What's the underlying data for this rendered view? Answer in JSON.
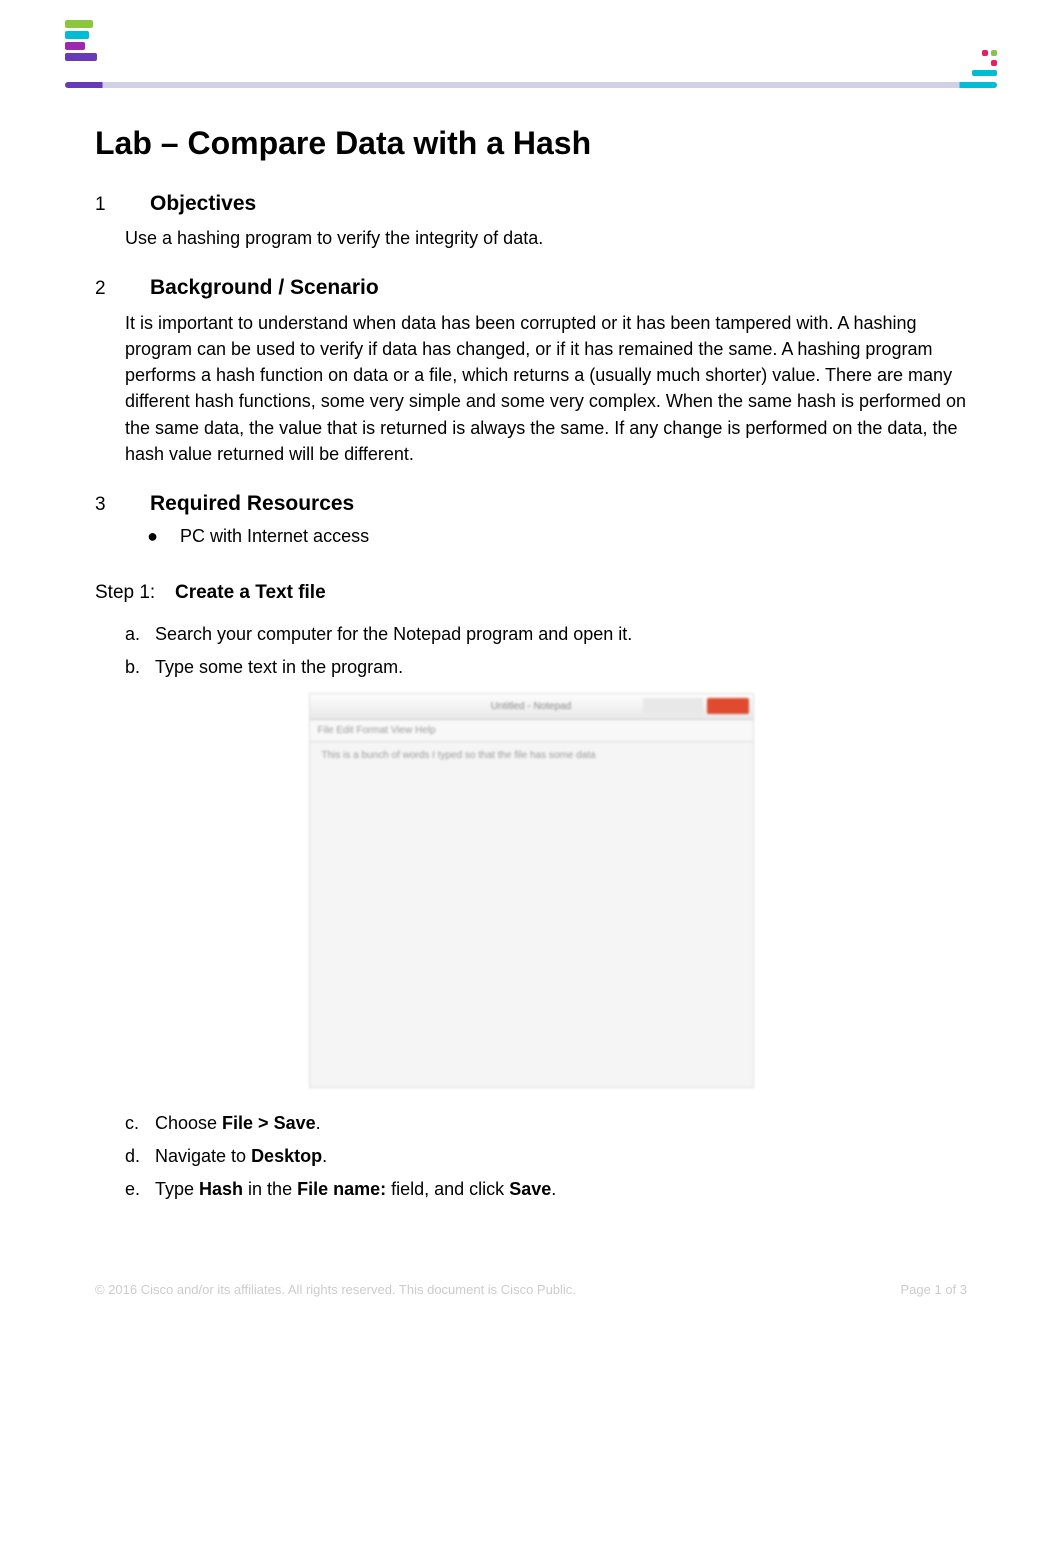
{
  "title": "Lab – Compare Data with a Hash",
  "sections": {
    "s1": {
      "num": "1",
      "title": "Objectives",
      "body": "Use a hashing program to verify the integrity of data."
    },
    "s2": {
      "num": "2",
      "title": "Background / Scenario",
      "body": "It is important to understand when data has been corrupted or it has been tampered with. A hashing program can be used to verify if data has changed, or if it has remained the same. A hashing program performs a hash function on data or a file, which returns a (usually much shorter) value. There are many different hash functions, some very simple and some very complex. When the same hash is performed on the same data, the value that is returned is always the same. If any change is performed on the data, the hash value returned will be different."
    },
    "s3": {
      "num": "3",
      "title": "Required Resources",
      "bullet": "PC with Internet access"
    }
  },
  "step1": {
    "label": "Step 1:",
    "title": "Create a Text file",
    "items": {
      "a": {
        "letter": "a.",
        "text": "Search your computer for the Notepad program and open it."
      },
      "b": {
        "letter": "b.",
        "text": "Type some text in the program."
      },
      "c": {
        "letter": "c.",
        "prefix": "Choose ",
        "bold": "File > Save",
        "suffix": "."
      },
      "d": {
        "letter": "d.",
        "prefix": "Navigate to ",
        "bold": "Desktop",
        "suffix": "."
      },
      "e": {
        "letter": "e.",
        "p1": "Type ",
        "b1": "Hash",
        "p2": " in the ",
        "b2": "File name:",
        "p3": " field, and click ",
        "b3": "Save",
        "p4": "."
      }
    }
  },
  "screenshot": {
    "title": "Untitled - Notepad",
    "menu": "File   Edit   Format   View   Help",
    "content": "This is a bunch of words I typed so that the file has some data"
  },
  "footer": {
    "copyright": "© 2016 Cisco and/or its affiliates. All rights reserved. This document is Cisco Public.",
    "page": "Page 1 of 3"
  }
}
